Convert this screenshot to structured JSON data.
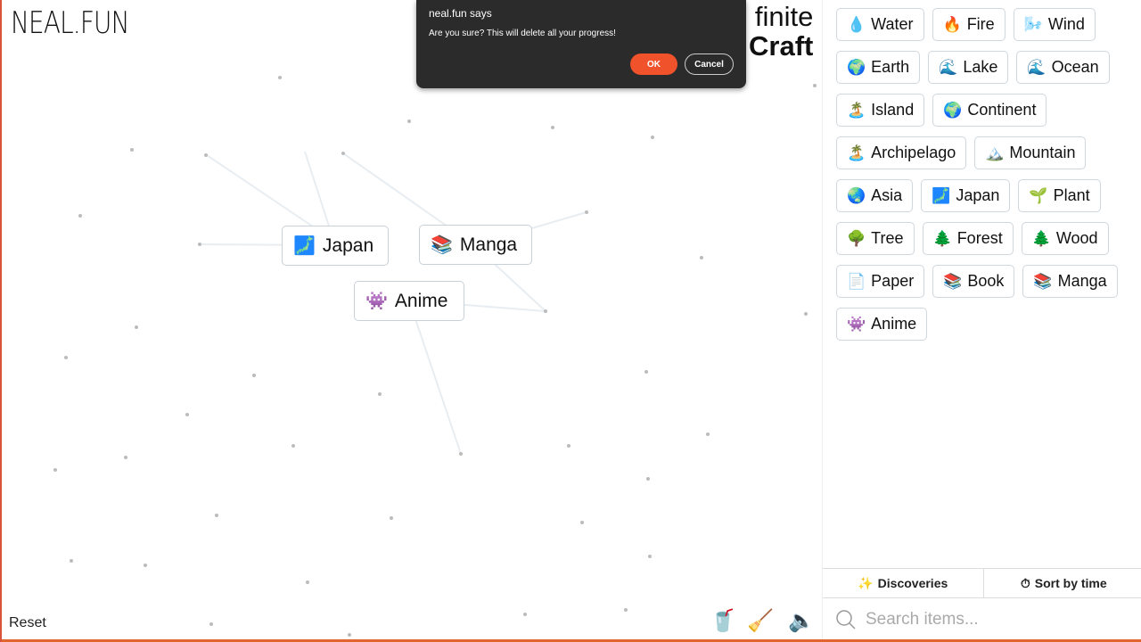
{
  "logo": "NEAL.FUN",
  "title": {
    "line1": "finite",
    "line2": "Craft"
  },
  "canvas_items": [
    {
      "emoji": "🗾",
      "label": "Japan"
    },
    {
      "emoji": "📚",
      "label": "Manga"
    },
    {
      "emoji": "👾",
      "label": "Anime"
    }
  ],
  "reset_label": "Reset",
  "tools": {
    "coffee": "🥤",
    "broom": "🧹",
    "sound": "🔈"
  },
  "sidebar": {
    "items": [
      {
        "emoji": "💧",
        "label": "Water"
      },
      {
        "emoji": "🔥",
        "label": "Fire"
      },
      {
        "emoji": "🌬️",
        "label": "Wind"
      },
      {
        "emoji": "🌍",
        "label": "Earth"
      },
      {
        "emoji": "🌊",
        "label": "Lake"
      },
      {
        "emoji": "🌊",
        "label": "Ocean"
      },
      {
        "emoji": "🏝️",
        "label": "Island"
      },
      {
        "emoji": "🌍",
        "label": "Continent"
      },
      {
        "emoji": "🏝️",
        "label": "Archipelago"
      },
      {
        "emoji": "🏔️",
        "label": "Mountain"
      },
      {
        "emoji": "🌏",
        "label": "Asia"
      },
      {
        "emoji": "🗾",
        "label": "Japan"
      },
      {
        "emoji": "🌱",
        "label": "Plant"
      },
      {
        "emoji": "🌳",
        "label": "Tree"
      },
      {
        "emoji": "🌲",
        "label": "Forest"
      },
      {
        "emoji": "🌲",
        "label": "Wood"
      },
      {
        "emoji": "📄",
        "label": "Paper"
      },
      {
        "emoji": "📚",
        "label": "Book"
      },
      {
        "emoji": "📚",
        "label": "Manga"
      },
      {
        "emoji": "👾",
        "label": "Anime"
      }
    ],
    "discoveries_label": "Discoveries",
    "sort_label": "Sort by time",
    "search_placeholder": "Search items..."
  },
  "dialog": {
    "title": "neal.fun says",
    "message": "Are you sure? This will delete all your progress!",
    "ok": "OK",
    "cancel": "Cancel"
  },
  "colors": {
    "accent": "#f0532b",
    "dialog_bg": "#2b2b2b",
    "border": "#e0662e"
  }
}
